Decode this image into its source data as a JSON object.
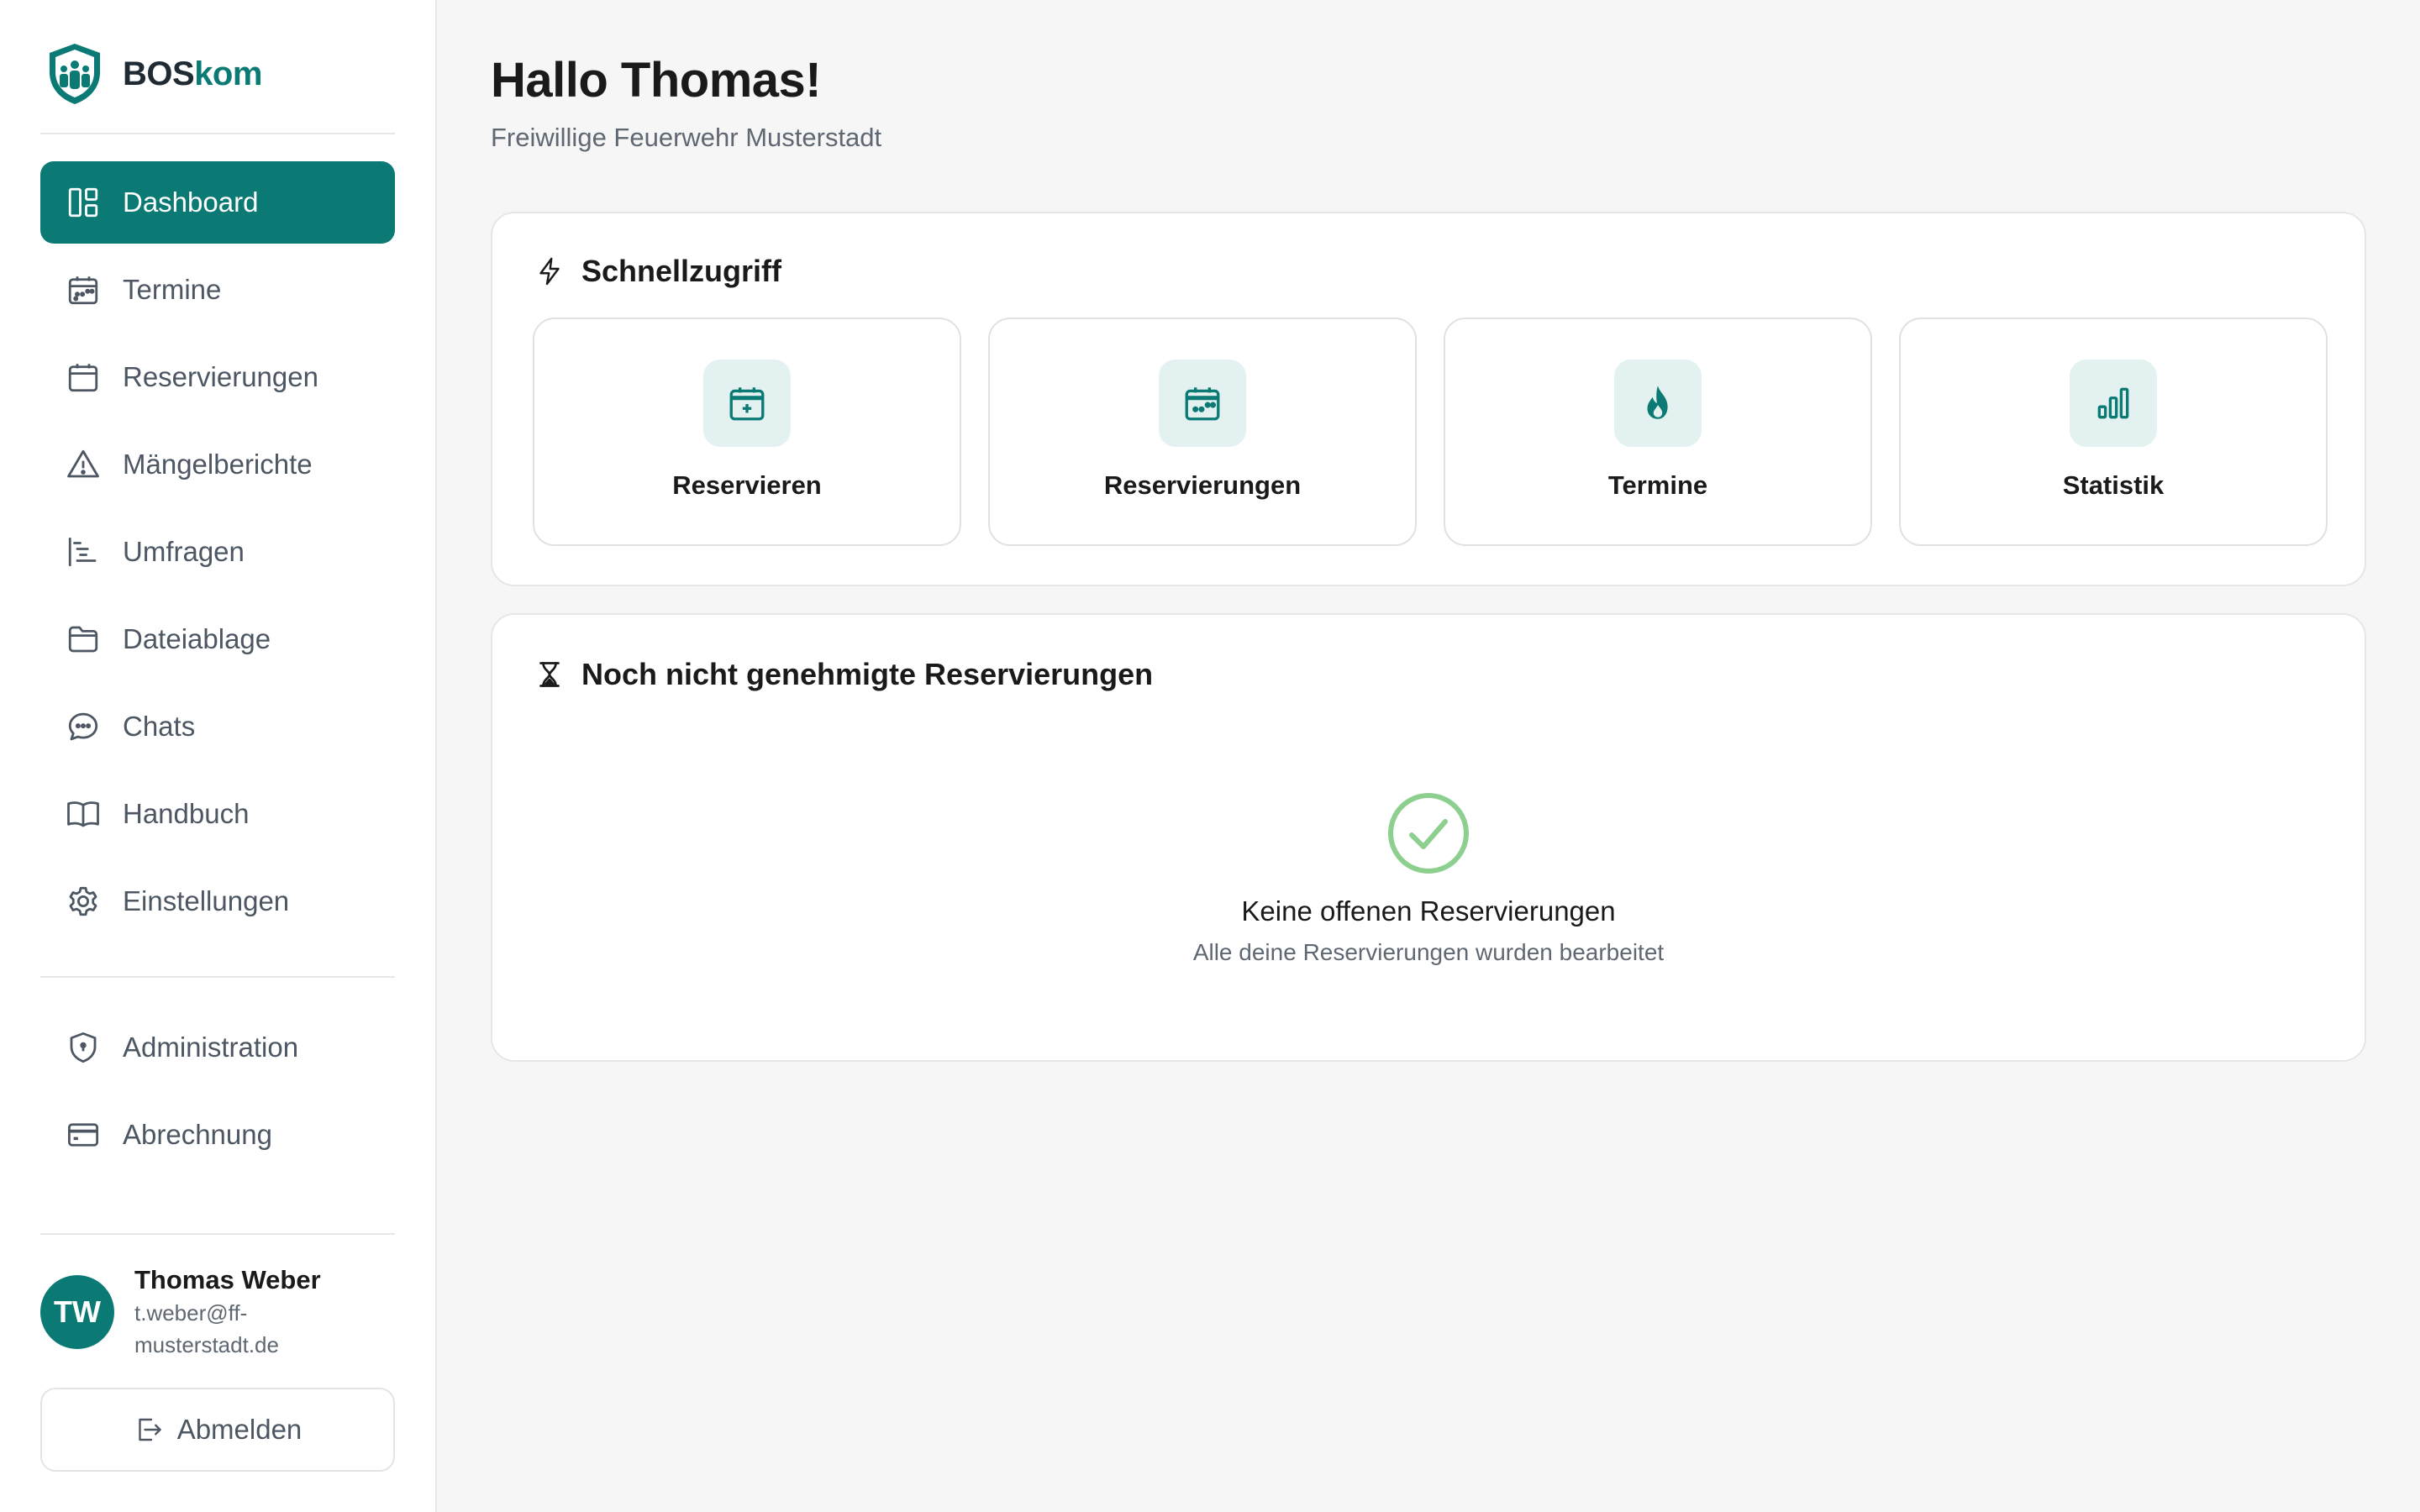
{
  "brand": {
    "name_part1": "BOS",
    "name_part2": "kom"
  },
  "colors": {
    "primary": "#0b7a74",
    "primary_light": "#e3f2f0",
    "success": "#8ccf8f"
  },
  "sidebar": {
    "items": [
      {
        "label": "Dashboard",
        "icon": "dashboard-icon",
        "active": true
      },
      {
        "label": "Termine",
        "icon": "calendar-icon"
      },
      {
        "label": "Reservierungen",
        "icon": "calendar-blank-icon"
      },
      {
        "label": "Mängelberichte",
        "icon": "warning-icon"
      },
      {
        "label": "Umfragen",
        "icon": "survey-icon"
      },
      {
        "label": "Dateiablage",
        "icon": "folder-icon"
      },
      {
        "label": "Chats",
        "icon": "chat-icon"
      },
      {
        "label": "Handbuch",
        "icon": "book-icon"
      },
      {
        "label": "Einstellungen",
        "icon": "gear-icon"
      }
    ],
    "admin_items": [
      {
        "label": "Administration",
        "icon": "shield-icon"
      },
      {
        "label": "Abrechnung",
        "icon": "credit-card-icon"
      }
    ]
  },
  "user": {
    "initials": "TW",
    "name": "Thomas Weber",
    "email": "t.weber@ff-musterstadt.de"
  },
  "logout_label": "Abmelden",
  "header": {
    "greeting": "Hallo Thomas!",
    "organization": "Freiwillige Feuerwehr Musterstadt"
  },
  "quick_access": {
    "title": "Schnellzugriff",
    "tiles": [
      {
        "label": "Reservieren",
        "icon": "calendar-plus-icon"
      },
      {
        "label": "Reservierungen",
        "icon": "calendar-icon"
      },
      {
        "label": "Termine",
        "icon": "flame-icon"
      },
      {
        "label": "Statistik",
        "icon": "bar-chart-icon"
      }
    ]
  },
  "pending": {
    "title": "Noch nicht genehmigte Reservierungen",
    "empty_title": "Keine offenen Reservierungen",
    "empty_subtitle": "Alle deine Reservierungen wurden bearbeitet"
  }
}
